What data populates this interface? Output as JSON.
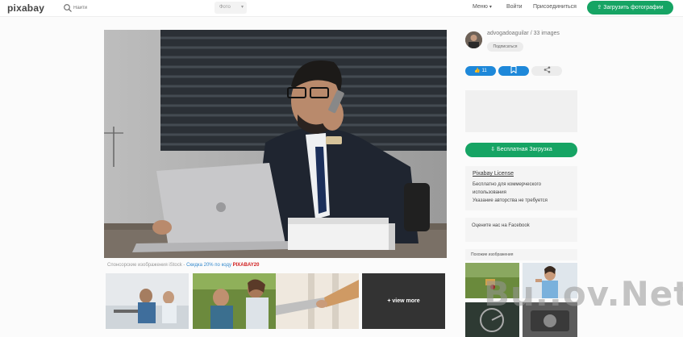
{
  "header": {
    "logo": "pixabay",
    "search_placeholder": "Найти",
    "search_type": "Фото",
    "nav": [
      "Меню",
      "Войти",
      "Присоединиться"
    ],
    "upload_label": "Загрузить фотографии"
  },
  "main": {
    "caption_prefix": "Спонсорские изображения iStock",
    "caption_sep": " - ",
    "promo_text": "Скидка 20% по коду ",
    "promo_code": "PIXABAY20",
    "view_more": "+ view more"
  },
  "sidebar": {
    "author": "advogadoaguilar / 33 images",
    "follow_label": "Подписаться",
    "like_count": "11",
    "download_label": "Бесплатная Загрузка",
    "license": {
      "title": "Pixabay License",
      "lines": [
        "Бесплатно для коммерческого",
        "использования",
        "Указание авторства не требуется"
      ]
    },
    "facebook_text": "Оцените нас на Facebook",
    "similar_label": "Похожие изображения"
  },
  "watermark": "Bu..ov.Net",
  "colors": {
    "brand_green": "#16a464",
    "like_blue": "#1e88d9",
    "promo_red": "#d01c1c"
  }
}
